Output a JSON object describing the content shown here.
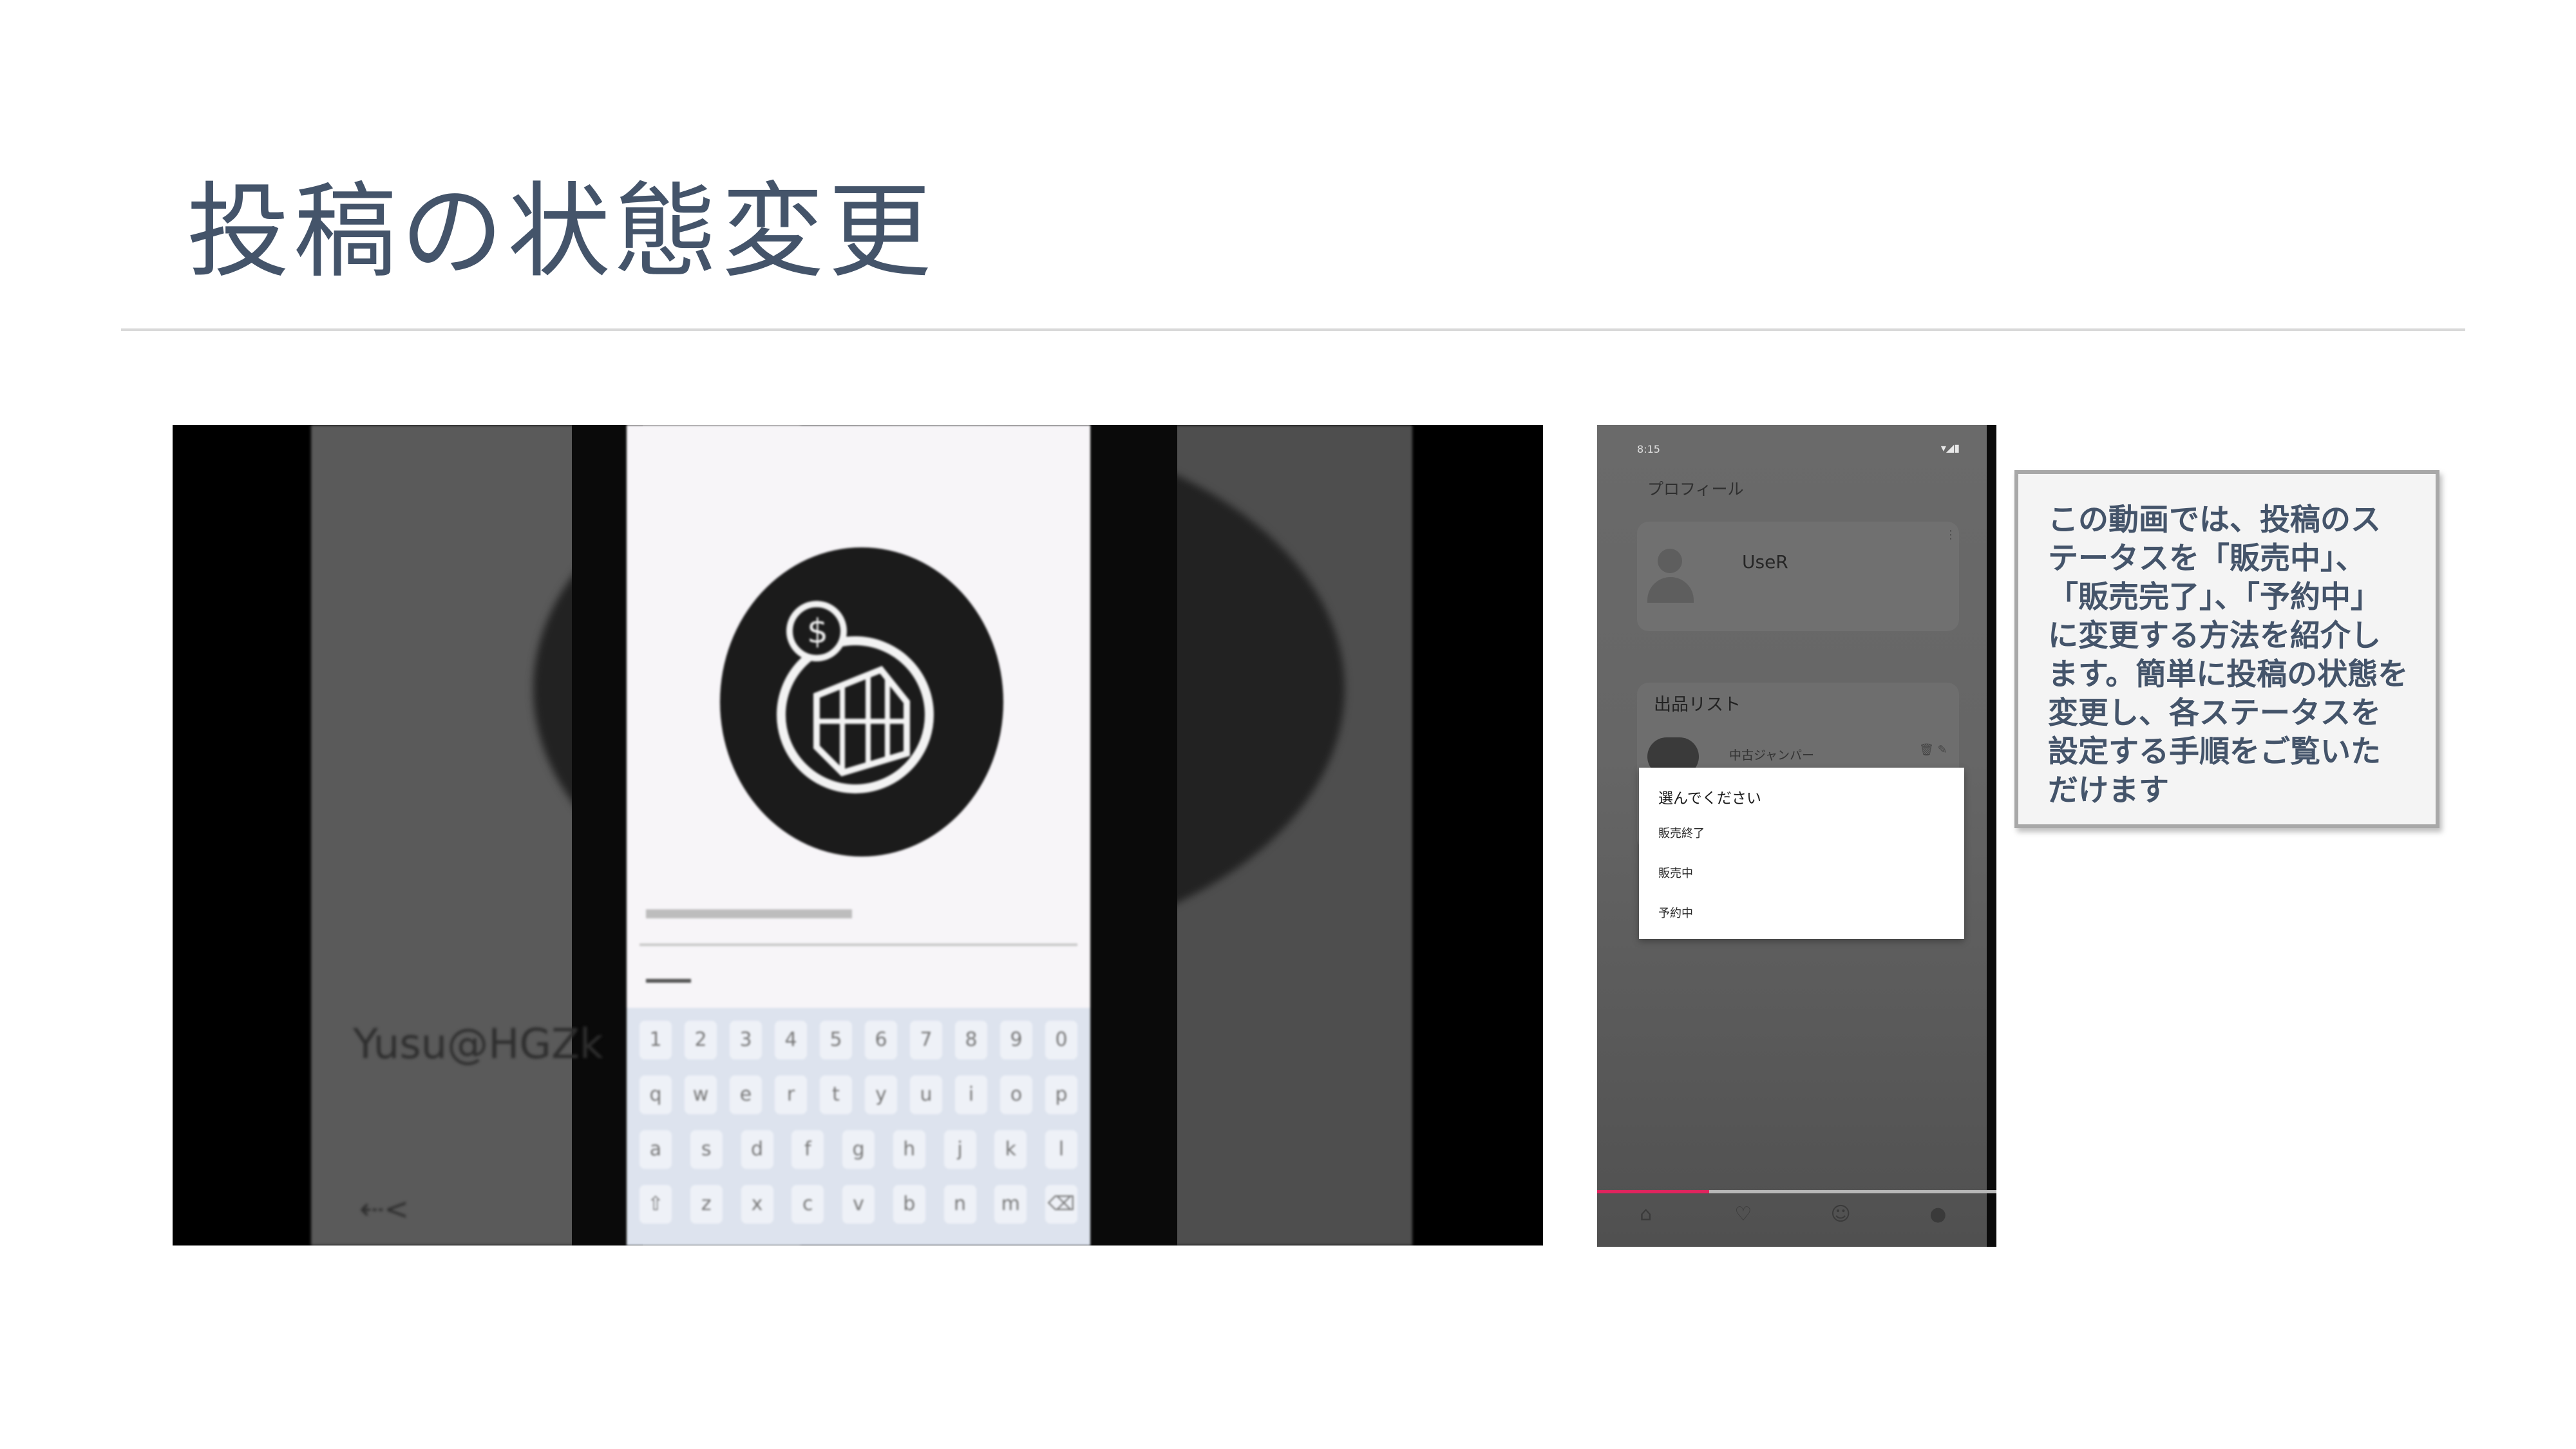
{
  "slide": {
    "title": "投稿の状態変更",
    "description": "この動画では、投稿のステータスを「販売中」、「販売完了」、「予約中」に変更する方法を紹介します。簡単に投稿の状態を変更し、各ステータスを設定する手順をご覧いただけます"
  },
  "left_video": {
    "handle_text": "Yusu@HGZk",
    "keyboard_rows": [
      [
        "1",
        "2",
        "3",
        "4",
        "5",
        "6",
        "7",
        "8",
        "9",
        "0"
      ],
      [
        "q",
        "w",
        "e",
        "r",
        "t",
        "y",
        "u",
        "i",
        "o",
        "p"
      ],
      [
        "a",
        "s",
        "d",
        "f",
        "g",
        "h",
        "j",
        "k",
        "l"
      ],
      [
        "⇧",
        "z",
        "x",
        "c",
        "v",
        "b",
        "n",
        "m",
        "⌫"
      ]
    ]
  },
  "phone": {
    "status_time": "8:15",
    "status_icons": "▾◢▮",
    "header_title": "プロフィール",
    "user_name": "UseR",
    "card_menu": "⋮",
    "listing_section_title": "出品リスト",
    "listing_item_title": "中古ジャンパー",
    "listing_item_icons": "🗑 ✎",
    "dialog": {
      "title": "選んでください",
      "options": [
        "販売終了",
        "販売中",
        "予約中"
      ]
    },
    "video_progress": 0.28,
    "nav_icons": [
      "home-icon",
      "heart-icon",
      "chat-icon",
      "person-icon"
    ],
    "nav_glyphs": [
      "⌂",
      "♡",
      "☺",
      "●"
    ]
  },
  "colors": {
    "title": "#44546a",
    "accent_progress": "#e0245e",
    "desc_border": "#a8a8a8"
  }
}
